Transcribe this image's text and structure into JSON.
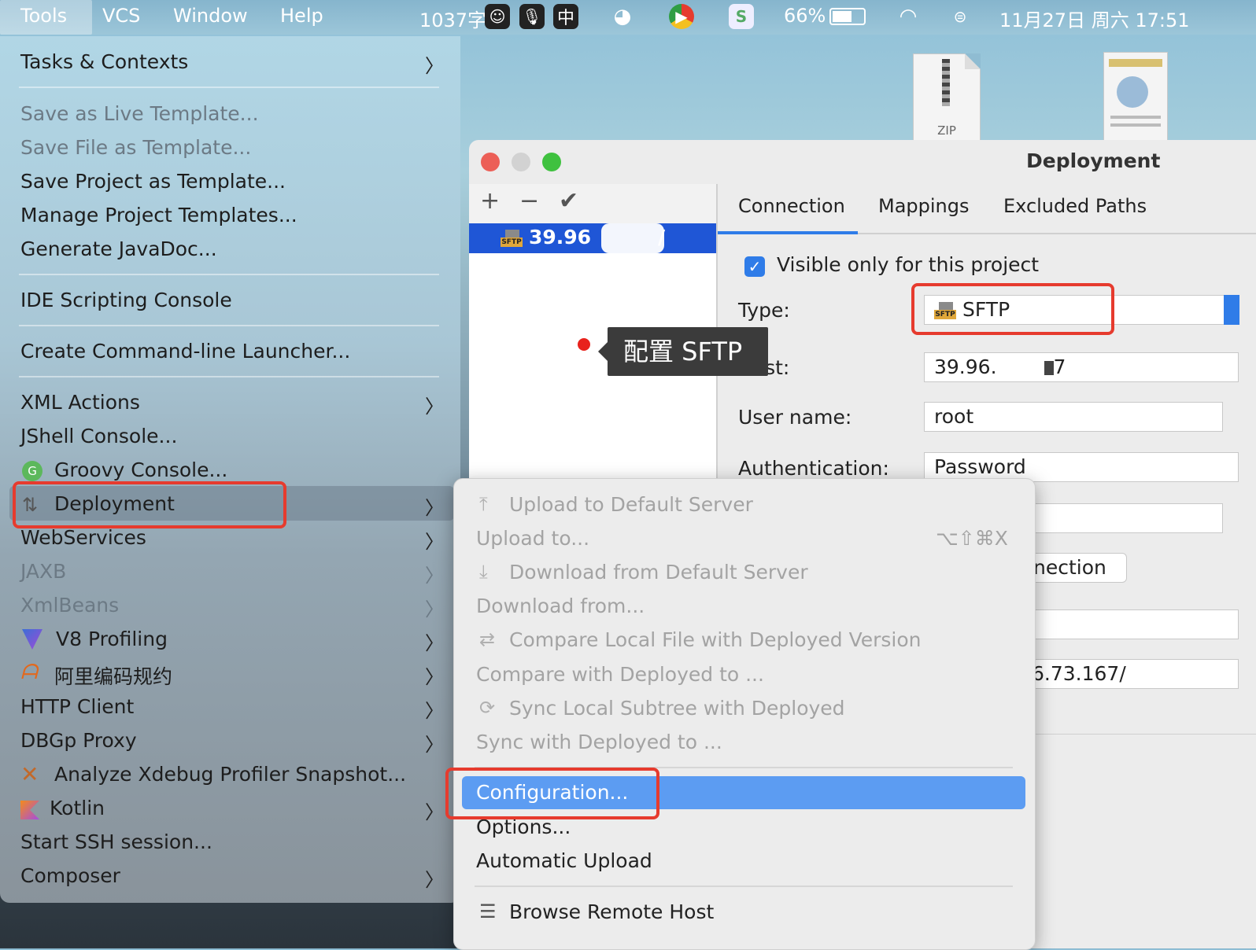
{
  "menubar": {
    "items": [
      "Tools",
      "VCS",
      "Window",
      "Help"
    ],
    "word_count": "1037字",
    "ime": "中",
    "battery": "66%",
    "datetime": "11月27日 周六  17:51"
  },
  "desktop": {
    "zip_label": "ZIP"
  },
  "tools_menu": {
    "tasks": "Tasks & Contexts",
    "save_live_template": "Save as Live Template...",
    "save_file_template": "Save File as Template...",
    "save_project_template": "Save Project as Template...",
    "manage_templates": "Manage Project Templates...",
    "generate_javadoc": "Generate JavaDoc...",
    "ide_scripting": "IDE Scripting Console",
    "create_launcher": "Create Command-line Launcher...",
    "xml_actions": "XML Actions",
    "jshell": "JShell Console...",
    "groovy": "Groovy Console...",
    "deployment": "Deployment",
    "webservices": "WebServices",
    "jaxb": "JAXB",
    "xmlbeans": "XmlBeans",
    "v8": "V8 Profiling",
    "alibaba": "阿里编码规约",
    "http_client": "HTTP Client",
    "dbgp": "DBGp Proxy",
    "xdebug": "Analyze Xdebug Profiler Snapshot...",
    "kotlin": "Kotlin",
    "ssh": "Start SSH session...",
    "composer": "Composer"
  },
  "dialog": {
    "title": "Deployment",
    "server_name": "39.96",
    "tabs": [
      "Connection",
      "Mappings",
      "Excluded Paths"
    ],
    "visible_only": "Visible only for this project",
    "type_label": "Type:",
    "type_value": "SFTP",
    "host_label": "Host:",
    "host_value": "39.96.",
    "host_suffix": "7",
    "user_label": "User name:",
    "user_value": "root",
    "auth_label": "Authentication:",
    "auth_value": "Password",
    "test_conn_partial": "nection",
    "root_path_partial": "6.73.167/",
    "tooltip": "配置 SFTP"
  },
  "submenu": {
    "upload_default": "Upload to Default Server",
    "upload_to": "Upload to...",
    "upload_to_shortcut": "⌥⇧⌘X",
    "download_default": "Download from Default Server",
    "download_from": "Download from...",
    "compare_local": "Compare Local File with Deployed Version",
    "compare_with": "Compare with Deployed to ...",
    "sync_local": "Sync Local Subtree with Deployed",
    "sync_with": "Sync with Deployed to ...",
    "configuration": "Configuration...",
    "options": "Options...",
    "automatic_upload": "Automatic Upload",
    "browse_remote": "Browse Remote Host"
  },
  "colors": {
    "highlight_red": "#e63b2e",
    "selection_blue": "#5c9cf2",
    "server_row_blue": "#1f56d6"
  }
}
